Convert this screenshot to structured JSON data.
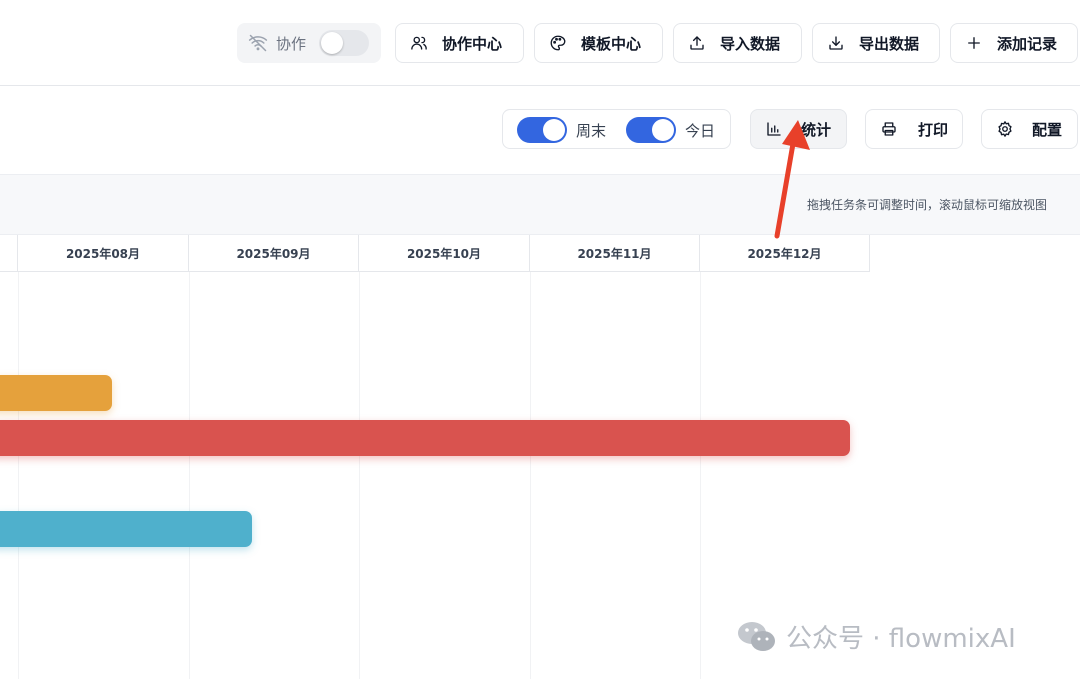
{
  "toolbar": {
    "collab_label": "协作",
    "collab_enabled": false,
    "collab_center": "协作中心",
    "template_center": "模板中心",
    "import_data": "导入数据",
    "export_data": "导出数据",
    "add_record": "添加记录"
  },
  "view_toolbar": {
    "weekend_label": "周末",
    "weekend_enabled": true,
    "today_label": "今日",
    "today_enabled": true,
    "stats_label": "统计",
    "print_label": "打印",
    "config_label": "配置"
  },
  "hint": "拖拽任务条可调整时间，滚动鼠标可缩放视图",
  "gantt": {
    "months": [
      "2025年08月",
      "2025年09月",
      "2025年10月",
      "2025年11月",
      "2025年12月"
    ],
    "task_colors": [
      "#e5a13c",
      "#d9534f",
      "#4fb0cc"
    ],
    "accent": "#3366e0"
  },
  "watermark": {
    "text": "公众号 · flowmixAI",
    "icon": "wechat-icon"
  }
}
